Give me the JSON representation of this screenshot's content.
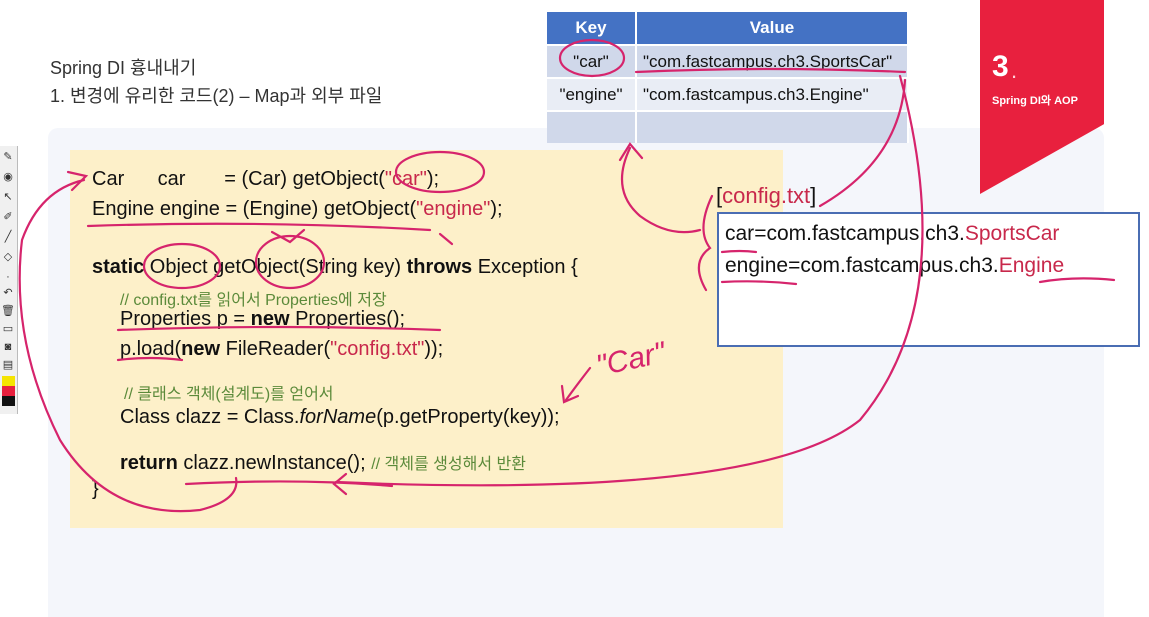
{
  "slide": {
    "title_line1": "Spring DI 흉내내기",
    "title_line2": "1. 변경에 유리한 코드(2) – Map과 외부 파일"
  },
  "badge": {
    "number": "3",
    "dot": ".",
    "subtitle": "Spring DI와 AOP"
  },
  "table": {
    "headers": [
      "Key",
      "Value"
    ],
    "rows": [
      [
        "\"car\"",
        "\"com.fastcampus.ch3.SportsCar\""
      ],
      [
        "\"engine\"",
        "\"com.fastcampus.ch3.Engine\""
      ],
      [
        "",
        ""
      ]
    ]
  },
  "code": {
    "l1_a": "Car      car       = (Car) getObject(",
    "l1_str": "\"car\"",
    "l1_b": ");",
    "l2_a": "Engine engine = (Engine) getObject(",
    "l2_str": "\"engine\"",
    "l2_b": ");",
    "l3_kw1": "static",
    "l3_a": " Object getObject(String key) ",
    "l3_kw2": "throws",
    "l3_b": " Exception {",
    "l4_comment": "// config.txt를 읽어서 Properties에 저장",
    "l5_a": "Properties p = ",
    "l5_kw": "new",
    "l5_b": " Properties();",
    "l6_a": "p.load(",
    "l6_kw": "new",
    "l6_b": " FileReader(",
    "l6_str": "\"config.txt\"",
    "l6_c": "));",
    "l7_comment": "// 클래스 객체(설계도)를 얻어서",
    "l8_a": "Class clazz = Class.",
    "l8_it": "forName",
    "l8_b": "(p.getProperty(key));",
    "l9_kw": "return",
    "l9_a": " clazz.newInstance(); ",
    "l9_comment": "// 객체를 생성해서 반환",
    "l10": "}"
  },
  "config": {
    "label_open": "[",
    "label_file": "config.txt",
    "label_close": "]",
    "line1_key": "car",
    "line1_mid": "=com.fastcampus.ch3.",
    "line1_val": "SportsCar",
    "line2_key": "engine",
    "line2_mid": "=com.fastcampus.ch3.",
    "line2_val": "Engine"
  },
  "annotation": {
    "note": "\"Car\""
  },
  "colors": {
    "string": "#c8284b",
    "annotation": "#d6246c",
    "header": "#4472c4",
    "badge": "#e8203e"
  }
}
